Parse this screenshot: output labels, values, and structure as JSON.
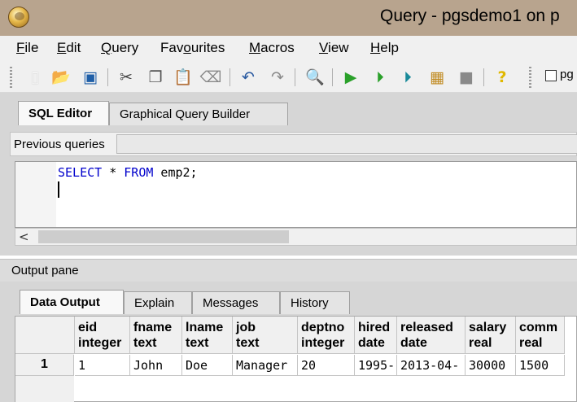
{
  "window": {
    "title": "Query - pgsdemo1 on p"
  },
  "menu": [
    {
      "label": "File",
      "ul": "F"
    },
    {
      "label": "Edit",
      "ul": "E"
    },
    {
      "label": "Query",
      "ul": "Q"
    },
    {
      "label": "Favourites",
      "ul": "o"
    },
    {
      "label": "Macros",
      "ul": "M"
    },
    {
      "label": "View",
      "ul": "V"
    },
    {
      "label": "Help",
      "ul": "H"
    }
  ],
  "toolbar": {
    "icons": [
      "new-file-icon",
      "open-folder-icon",
      "save-icon",
      "cut-icon",
      "copy-icon",
      "paste-icon",
      "clear-icon",
      "undo-icon",
      "redo-icon",
      "find-icon",
      "execute-icon",
      "explain-icon",
      "execute-to-file-icon",
      "explain-options-icon",
      "stop-icon",
      "help-icon"
    ],
    "checkbox_label": "pg"
  },
  "editor_tabs": [
    "SQL Editor",
    "Graphical Query Builder"
  ],
  "previous_queries_label": "Previous queries",
  "sql": {
    "keyword1": "SELECT",
    "op": " * ",
    "keyword2": "FROM",
    "rest": " emp2;"
  },
  "output": {
    "pane_label": "Output pane",
    "tabs": [
      "Data Output",
      "Explain",
      "Messages",
      "History"
    ],
    "columns": [
      {
        "name": "eid",
        "type": "integer"
      },
      {
        "name": "fname",
        "type": "text"
      },
      {
        "name": "lname",
        "type": "text"
      },
      {
        "name": "job",
        "type": "text"
      },
      {
        "name": "deptno",
        "type": "integer"
      },
      {
        "name": "hired",
        "type": "date"
      },
      {
        "name": "released",
        "type": "date"
      },
      {
        "name": "salary",
        "type": "real"
      },
      {
        "name": "comm",
        "type": "real"
      }
    ],
    "rows": [
      {
        "num": "1",
        "cells": [
          "1",
          "John",
          "Doe",
          "Manager",
          "20",
          "1995-",
          "2013-04-",
          "30000",
          "1500"
        ]
      }
    ]
  },
  "colors": {
    "titlebar": "#b8a48e",
    "keyword": "#0000cc"
  }
}
